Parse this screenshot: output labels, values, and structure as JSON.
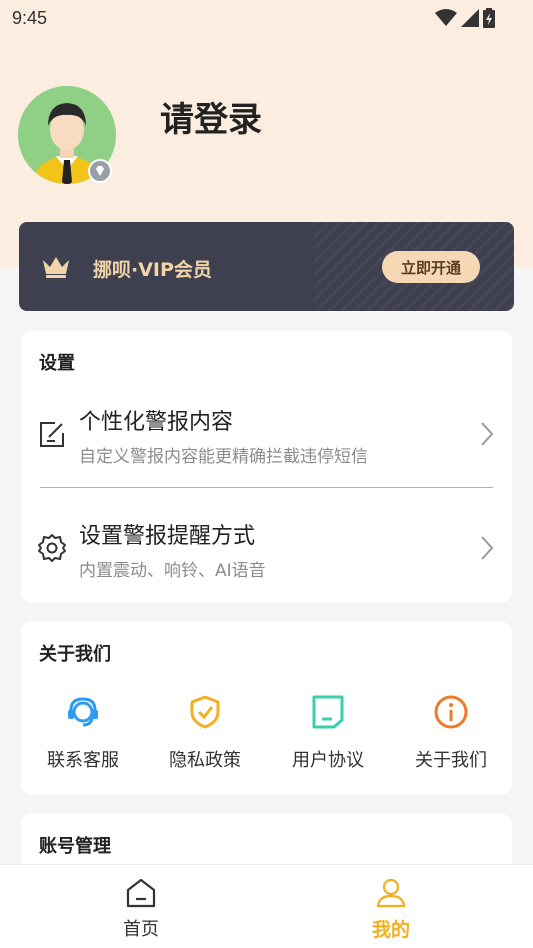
{
  "status_bar": {
    "time": "9:45"
  },
  "profile": {
    "login_prompt": "请登录"
  },
  "vip": {
    "label": "挪呗·VIP会员",
    "button": "立即开通"
  },
  "settings": {
    "title": "设置",
    "items": [
      {
        "title": "个性化警报内容",
        "subtitle": "自定义警报内容能更精确拦截违停短信",
        "icon": "edit-icon"
      },
      {
        "title": "设置警报提醒方式",
        "subtitle": "内置震动、响铃、AI语音",
        "icon": "gear-icon"
      }
    ]
  },
  "about": {
    "title": "关于我们",
    "items": [
      {
        "label": "联系客服",
        "icon": "headset-icon",
        "color": "#2f9bef"
      },
      {
        "label": "隐私政策",
        "icon": "shield-check-icon",
        "color": "#f2b01e"
      },
      {
        "label": "用户协议",
        "icon": "document-icon",
        "color": "#3ccfa9"
      },
      {
        "label": "关于我们",
        "icon": "info-icon",
        "color": "#f07a2a"
      }
    ]
  },
  "account": {
    "title": "账号管理"
  },
  "tabs": [
    {
      "label": "首页",
      "icon": "home-icon",
      "active": false
    },
    {
      "label": "我的",
      "icon": "user-icon",
      "active": true
    }
  ],
  "colors": {
    "header_bg": "#fbeee0",
    "vip_card": "#3f404f",
    "vip_text": "#f1d4a8",
    "active_tab": "#f2b01e"
  }
}
